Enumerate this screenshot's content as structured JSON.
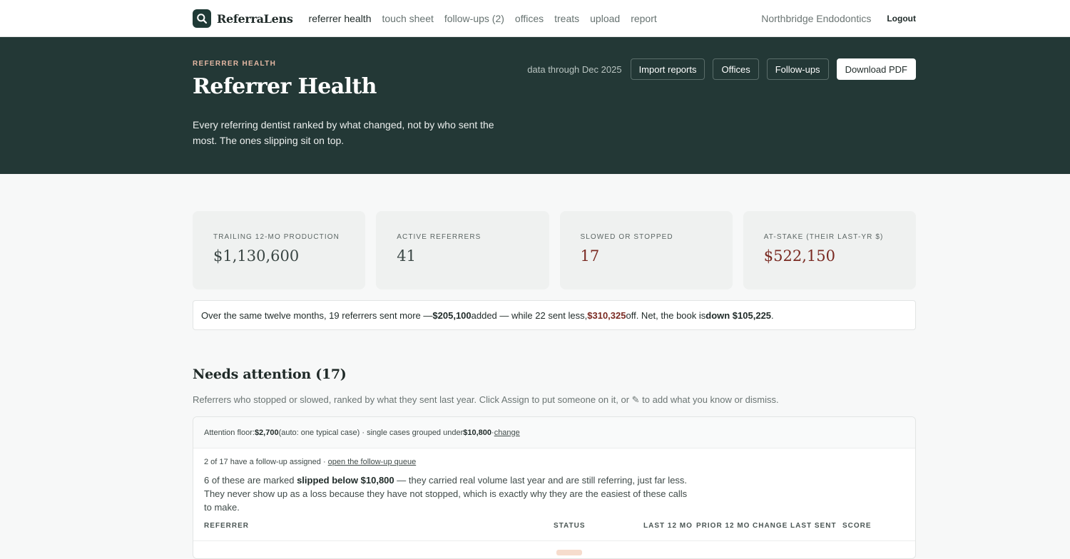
{
  "nav": {
    "brand": "ReferraLens",
    "links": [
      "referrer health",
      "touch sheet",
      "follow-ups (2)",
      "offices",
      "treats",
      "upload",
      "report"
    ],
    "active_index": 0,
    "practice": "Northbridge Endodontics",
    "logout": "Logout"
  },
  "hero": {
    "eyebrow": "REFERRER HEALTH",
    "title": "Referrer Health",
    "description": "Every referring dentist ranked by what changed, not by who sent the most. The ones slipping sit on top.",
    "data_through": "data through Dec 2025",
    "buttons": {
      "import": "Import reports",
      "offices": "Offices",
      "followups": "Follow-ups",
      "download": "Download PDF"
    }
  },
  "stats": [
    {
      "label": "TRAILING 12-MO PRODUCTION",
      "value": "$1,130,600",
      "tone": "neutral"
    },
    {
      "label": "ACTIVE REFERRERS",
      "value": "41",
      "tone": "neutral"
    },
    {
      "label": "SLOWED OR STOPPED",
      "value": "17",
      "tone": "bad"
    },
    {
      "label": "AT-STAKE (THEIR LAST-YR $)",
      "value": "$522,150",
      "tone": "bad"
    }
  ],
  "summary": {
    "p1": "Over the same twelve months, 19 referrers sent more — ",
    "added": "$205,100",
    "p2": " added — while 22 sent less, ",
    "off": "$310,325",
    "p3": " off. Net, the book is ",
    "net": "down $105,225",
    "p4": "."
  },
  "attention": {
    "title": "Needs attention (17)",
    "subtitle": "Referrers who stopped or slowed, ranked by what they sent last year. Click Assign to put someone on it, or ✎ to add what you know or dismiss.",
    "floor": {
      "p1": "Attention floor: ",
      "amount": "$2,700",
      "p2": " (auto: one typical case) · single cases grouped under ",
      "group": "$10,800",
      "p3": " · ",
      "change": "change"
    },
    "assigned": {
      "text": "2 of 17 have a follow-up assigned · ",
      "link": "open the follow-up queue"
    },
    "note": {
      "p1": "6 of these are marked ",
      "bold": "slipped below $10,800",
      "p2": " — they carried real volume last year and are still referring, just far less. They never show up as a loss because they have not stopped, which is exactly why they are the easiest of these calls to make."
    },
    "columns": [
      "REFERRER",
      "STATUS",
      "LAST 12 MO",
      "PRIOR 12 MO",
      "CHANGE",
      "LAST SENT",
      "SCORE"
    ]
  },
  "colors": {
    "hero_bg": "#233836",
    "accent_bad": "#7a2a22",
    "eyebrow": "#e4b8a3"
  },
  "icons": {
    "logo": "search-icon"
  }
}
